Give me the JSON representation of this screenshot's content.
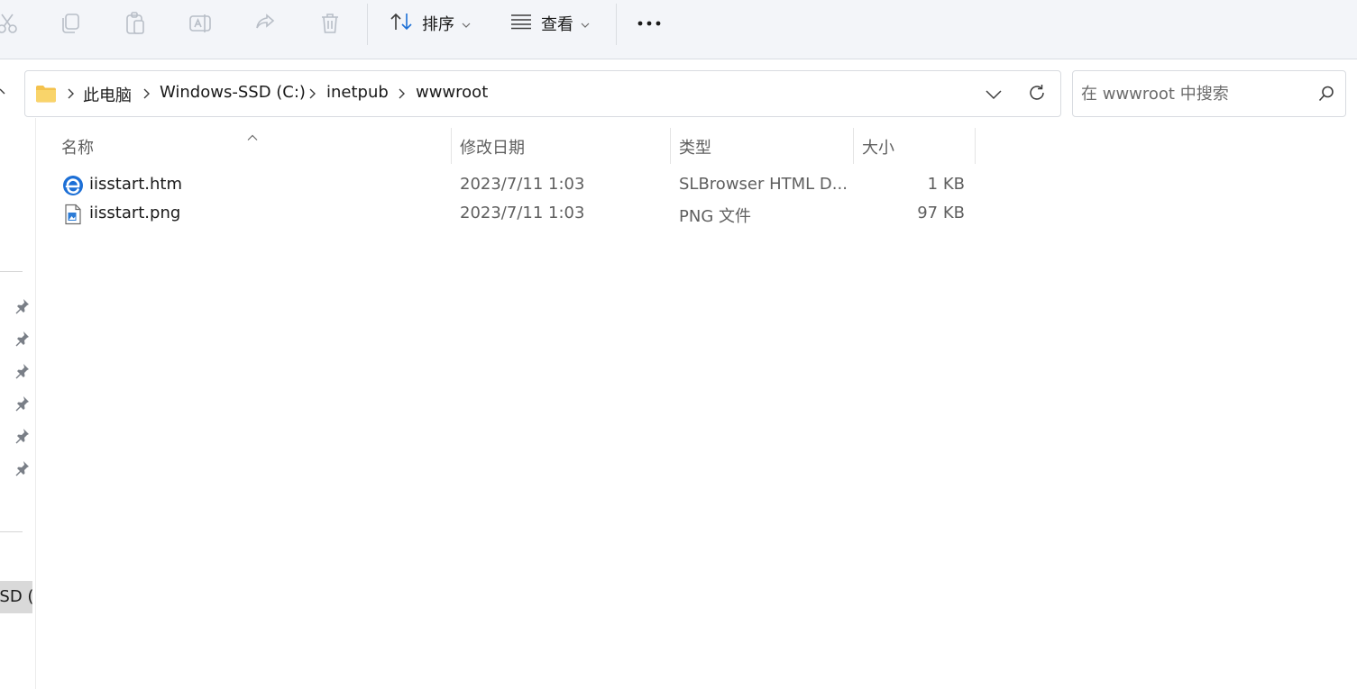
{
  "toolbar": {
    "icons": [
      "cut-icon",
      "copy-icon",
      "paste-icon",
      "rename-icon",
      "share-icon",
      "delete-icon"
    ],
    "sort_label": "排序",
    "view_label": "查看",
    "more_label": "···"
  },
  "address": {
    "breadcrumbs": [
      "此电脑",
      "Windows-SSD (C:)",
      "inetpub",
      "wwwroot"
    ]
  },
  "search": {
    "placeholder": "在 wwwroot 中搜索"
  },
  "nav": {
    "drive_label": "SSD (C"
  },
  "list": {
    "columns": {
      "name": "名称",
      "date": "修改日期",
      "type": "类型",
      "size": "大小"
    },
    "rows": [
      {
        "name": "iisstart.htm",
        "date": "2023/7/11 1:03",
        "type": "SLBrowser HTML D...",
        "size": "1 KB",
        "icon": "browser-html-icon"
      },
      {
        "name": "iisstart.png",
        "date": "2023/7/11 1:03",
        "type": "PNG 文件",
        "size": "97 KB",
        "icon": "png-file-icon"
      }
    ]
  },
  "colors": {
    "toolbar_bg": "#f3f5f9",
    "accent": "#1c6fd6",
    "folder": "#f4c24d"
  }
}
